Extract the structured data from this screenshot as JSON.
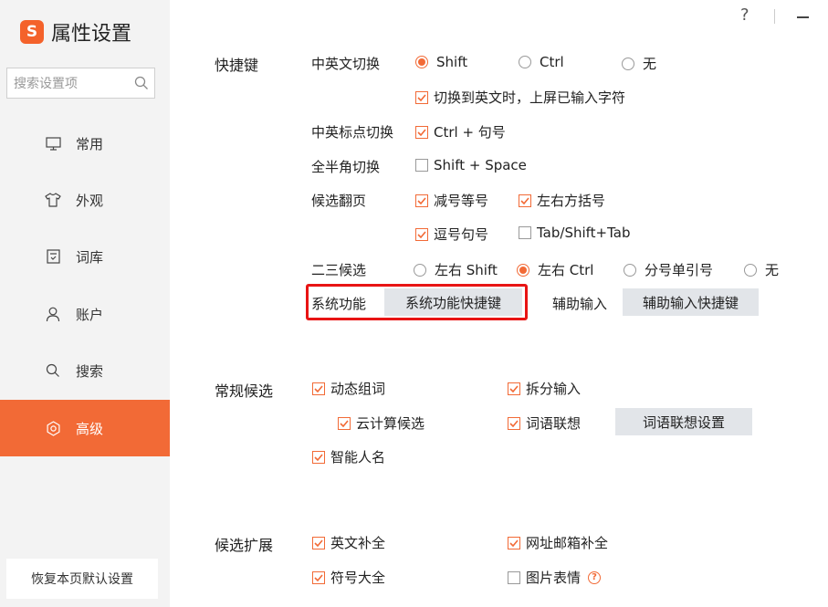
{
  "app": {
    "title": "属性设置",
    "logo_text": "S"
  },
  "titlebar": {
    "help": "?"
  },
  "search": {
    "placeholder": "搜索设置项"
  },
  "sidebar": {
    "items": [
      {
        "label": "常用",
        "icon": "monitor-icon"
      },
      {
        "label": "外观",
        "icon": "shirt-icon"
      },
      {
        "label": "词库",
        "icon": "book-icon"
      },
      {
        "label": "账户",
        "icon": "user-icon"
      },
      {
        "label": "搜索",
        "icon": "search-icon"
      },
      {
        "label": "高级",
        "icon": "gear-icon",
        "active": true
      }
    ],
    "restore": "恢复本页默认设置"
  },
  "shortcut": {
    "section": "快捷键",
    "cn_en_label": "中英文切换",
    "cn_en_options": [
      "Shift",
      "Ctrl",
      "无"
    ],
    "cn_en_selected": "Shift",
    "commit_on_switch": "切换到英文时，上屏已输入字符",
    "punct_label": "中英标点切换",
    "punct_option": "Ctrl + 句号",
    "width_label": "全半角切换",
    "width_option": "Shift + Space",
    "page_label": "候选翻页",
    "page_options": [
      "减号等号",
      "左右方括号",
      "逗号句号",
      "Tab/Shift+Tab"
    ],
    "second_third_label": "二三候选",
    "second_third_options": [
      "左右 Shift",
      "左右 Ctrl",
      "分号单引号",
      "无"
    ],
    "second_third_selected": "左右 Ctrl",
    "sys_func_label": "系统功能",
    "sys_func_button": "系统功能快捷键",
    "aux_input_label": "辅助输入",
    "aux_input_button": "辅助输入快捷键"
  },
  "regular": {
    "section": "常规候选",
    "dynamic_words": "动态组词",
    "split_input": "拆分输入",
    "cloud": "云计算候选",
    "association": "词语联想",
    "association_button": "词语联想设置",
    "smart_names": "智能人名"
  },
  "extension": {
    "section": "候选扩展",
    "english_complete": "英文补全",
    "url_mail_complete": "网址邮箱补全",
    "symbols": "符号大全",
    "image_emoji": "图片表情"
  },
  "colors": {
    "accent": "#f26a36",
    "highlight": "#e81414",
    "button": "#e2e5e9"
  }
}
